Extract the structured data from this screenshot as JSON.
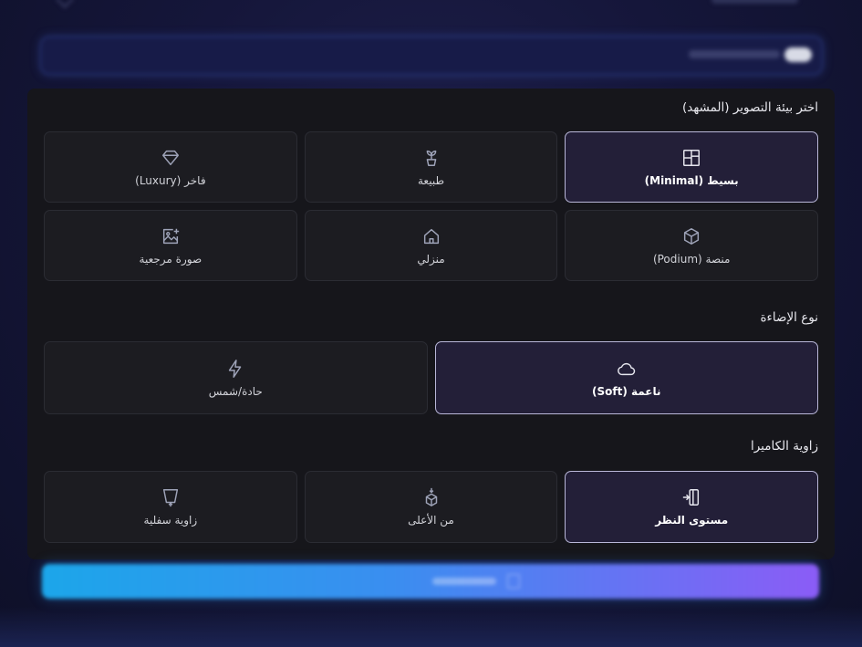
{
  "scene": {
    "title": "اختر بيئة التصوير (المشهد)",
    "options": [
      {
        "label": "بسيط (Minimal)",
        "icon": "layout-icon",
        "selected": true
      },
      {
        "label": "طبيعة",
        "icon": "plant-icon",
        "selected": false
      },
      {
        "label": "فاخر (Luxury)",
        "icon": "diamond-icon",
        "selected": false
      },
      {
        "label": "منصة (Podium)",
        "icon": "cube-icon",
        "selected": false
      },
      {
        "label": "منزلي",
        "icon": "home-icon",
        "selected": false
      },
      {
        "label": "صورة مرجعية",
        "icon": "image-plus-icon",
        "selected": false
      }
    ]
  },
  "lighting": {
    "title": "نوع الإضاءة",
    "options": [
      {
        "label": "ناعمة (Soft)",
        "icon": "cloud-icon",
        "selected": true
      },
      {
        "label": "حادة/شمس",
        "icon": "bolt-icon",
        "selected": false
      }
    ]
  },
  "camera": {
    "title": "زاوية الكاميرا",
    "options": [
      {
        "label": "مستوى النظر",
        "icon": "eye-level-icon",
        "selected": true
      },
      {
        "label": "من الأعلى",
        "icon": "top-down-icon",
        "selected": false
      },
      {
        "label": "زاوية سفلية",
        "icon": "low-angle-icon",
        "selected": false
      }
    ]
  },
  "colors": {
    "accent_start": "#1ca6ea",
    "accent_end": "#8b5cf6",
    "selected_bg": "#231f38",
    "panel_bg": "#16161b"
  }
}
